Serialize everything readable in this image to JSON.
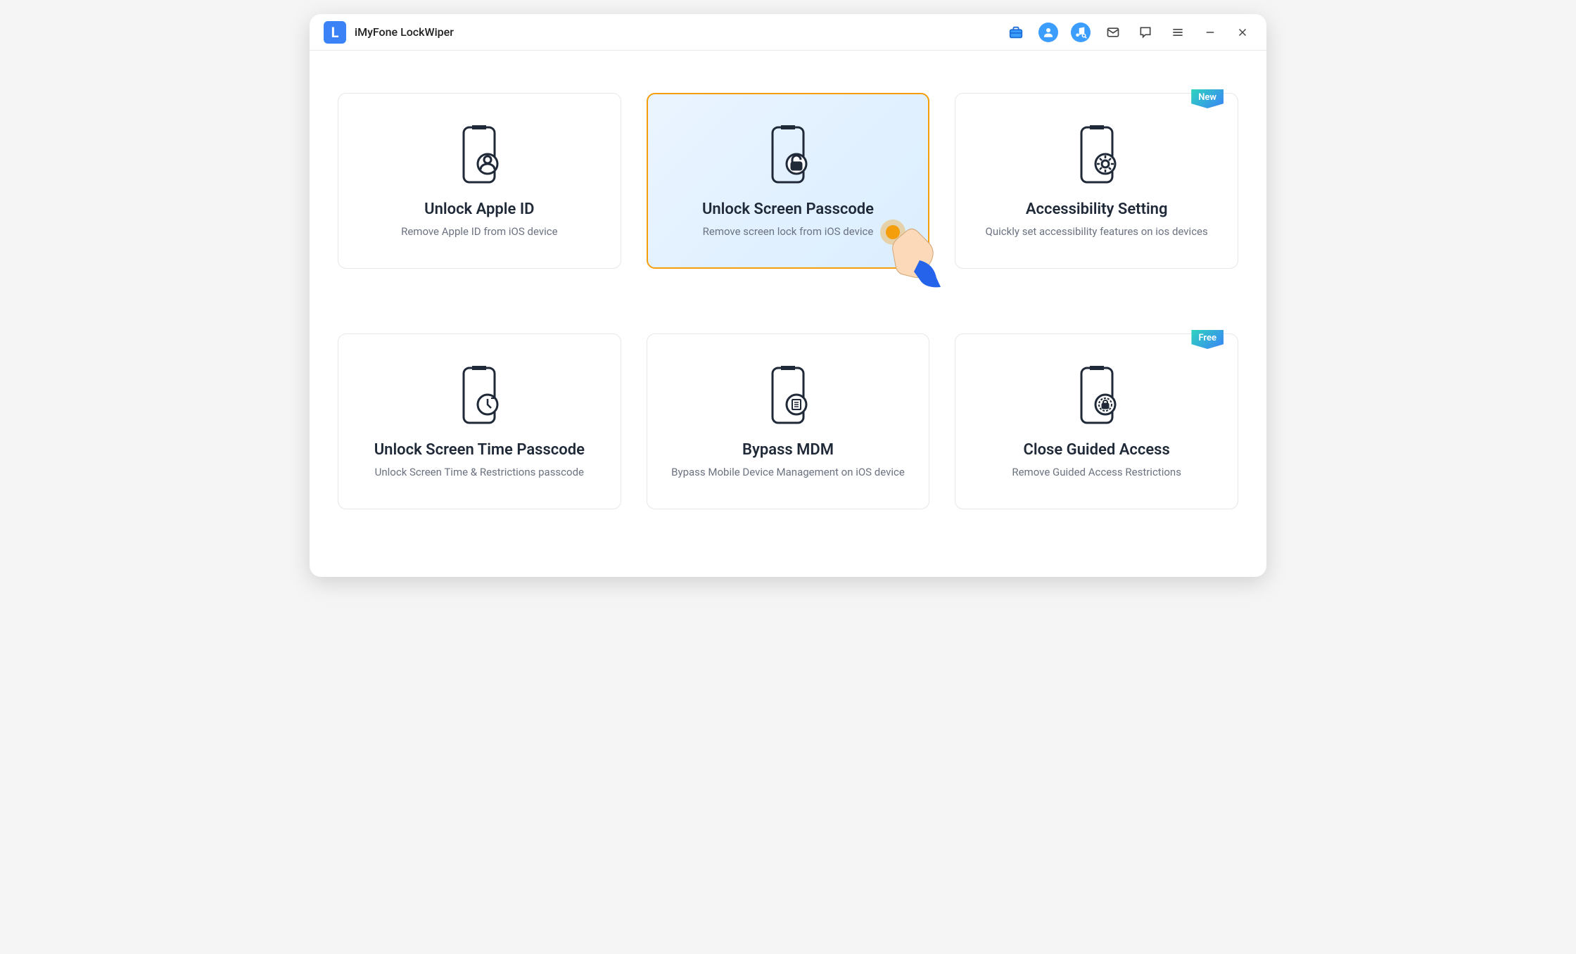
{
  "header": {
    "app_title": "iMyFone LockWiper"
  },
  "cards": [
    {
      "title": "Unlock Apple ID",
      "desc": "Remove Apple ID from iOS device",
      "icon": "apple-id",
      "selected": false,
      "badge": null
    },
    {
      "title": "Unlock Screen Passcode",
      "desc": "Remove screen lock from iOS device",
      "icon": "screen-passcode",
      "selected": true,
      "badge": null
    },
    {
      "title": "Accessibility Setting",
      "desc": "Quickly set accessibility features on ios devices",
      "icon": "accessibility",
      "selected": false,
      "badge": "New"
    },
    {
      "title": "Unlock Screen Time Passcode",
      "desc": "Unlock Screen Time & Restrictions passcode",
      "icon": "screen-time",
      "selected": false,
      "badge": null
    },
    {
      "title": "Bypass MDM",
      "desc": "Bypass Mobile Device Management on iOS device",
      "icon": "mdm",
      "selected": false,
      "badge": null
    },
    {
      "title": "Close Guided Access",
      "desc": "Remove Guided Access Restrictions",
      "icon": "guided-access",
      "selected": false,
      "badge": "Free"
    }
  ]
}
